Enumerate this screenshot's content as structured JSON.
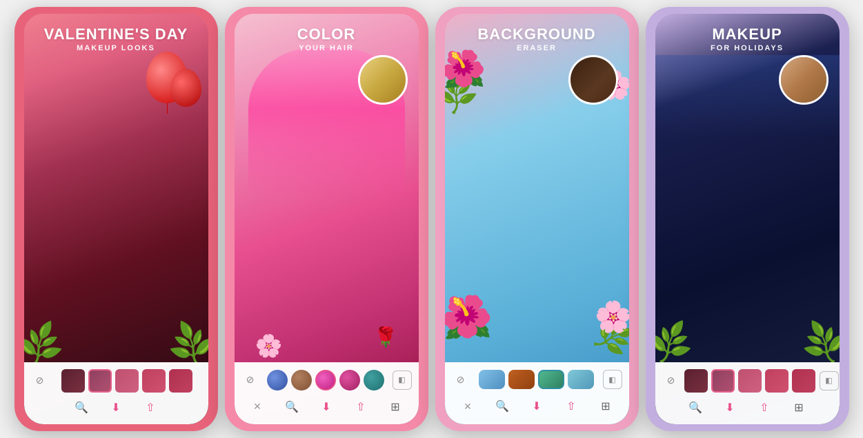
{
  "cards": [
    {
      "id": "card-1",
      "bg_color": "#e8637a",
      "title": "VALENTINE'S DAY",
      "subtitle": "MAKEUP LOOKS",
      "swatches": [
        {
          "color": "#6b3040",
          "type": "face"
        },
        {
          "color": "#a04060",
          "type": "face"
        },
        {
          "color": "#c05070",
          "type": "face"
        },
        {
          "color": "#d06080",
          "type": "face"
        },
        {
          "color": "#e07090",
          "type": "face"
        }
      ],
      "tools": [
        "magnify",
        "download",
        "share"
      ],
      "has_x": false,
      "has_compare": false
    },
    {
      "id": "card-2",
      "bg_color": "#f589a8",
      "title": "COLOR",
      "subtitle": "YOUR HAIR",
      "swatches": [
        {
          "color": "#4a6bc0",
          "type": "color"
        },
        {
          "color": "#8b6040",
          "type": "color"
        },
        {
          "color": "#e840a0",
          "type": "color"
        },
        {
          "color": "#cc3080",
          "type": "color"
        },
        {
          "color": "#2a8080",
          "type": "color"
        }
      ],
      "tools": [
        "x",
        "magnify",
        "download",
        "share",
        "extra"
      ],
      "has_x": true,
      "has_compare": true
    },
    {
      "id": "card-3",
      "bg_color": "#f0a0b8",
      "title": "BACKGROUND",
      "subtitle": "ERASER",
      "swatches": [
        {
          "color": "#60b0e0",
          "type": "color"
        },
        {
          "color": "#8b4510",
          "type": "color"
        },
        {
          "color": "#2a8050",
          "type": "color"
        },
        {
          "color": "#60b0d0",
          "type": "color"
        }
      ],
      "tools": [
        "x",
        "magnify",
        "download",
        "share",
        "extra"
      ],
      "has_x": true,
      "has_compare": true
    },
    {
      "id": "card-4",
      "bg_color": "#c3aee0",
      "title": "MAKEUP",
      "subtitle": "FOR HOLIDAYS",
      "swatches": [
        {
          "color": "#6b3040",
          "type": "face"
        },
        {
          "color": "#a04060",
          "type": "face"
        },
        {
          "color": "#c05070",
          "type": "face"
        },
        {
          "color": "#d06080",
          "type": "face"
        },
        {
          "color": "#e07090",
          "type": "face"
        }
      ],
      "tools": [
        "magnify",
        "download",
        "share",
        "extra"
      ],
      "has_x": false,
      "has_compare": true
    }
  ]
}
